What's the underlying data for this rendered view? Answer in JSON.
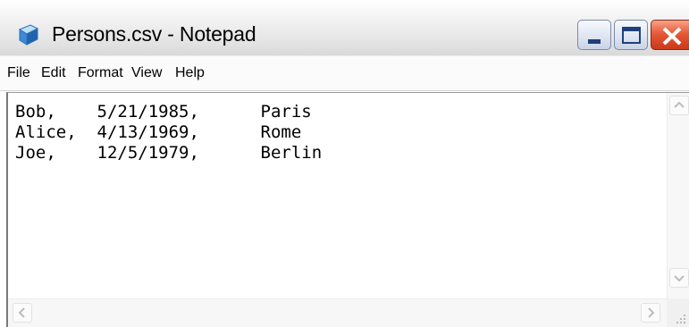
{
  "window": {
    "title": "Persons.csv - Notepad",
    "app_icon": "notepad-icon",
    "controls": {
      "minimize": "minimize-icon",
      "maximize": "maximize-icon",
      "close": "close-icon"
    }
  },
  "menu": [
    "File",
    "Edit",
    "Format",
    "View",
    "Help"
  ],
  "document": {
    "lines": [
      "Bob,    5/21/1985,      Paris",
      "Alice,  4/13/1969,      Rome",
      "Joe,    12/5/1979,      Berlin"
    ]
  },
  "colors": {
    "close_button": "#e65a37",
    "icon_blue": "#3c8ad8"
  }
}
